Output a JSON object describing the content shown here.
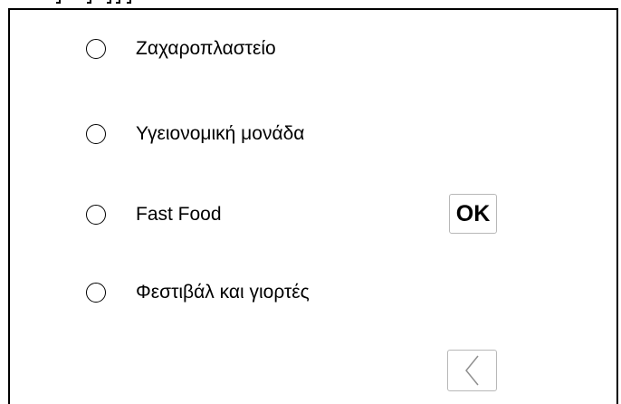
{
  "options": [
    {
      "label": "Ζαχαροπλαστείο",
      "selected": false
    },
    {
      "label": "Υγειονομική μονάδα",
      "selected": false
    },
    {
      "label": "Fast Food",
      "selected": false
    },
    {
      "label": "Φεστιβάλ και γιορτές",
      "selected": false
    }
  ],
  "buttons": {
    "ok_label": "OK",
    "back_icon": "chevron-left-icon"
  },
  "colors": {
    "border": "#000000",
    "button_border": "#b8b8b8",
    "background": "#ffffff"
  }
}
